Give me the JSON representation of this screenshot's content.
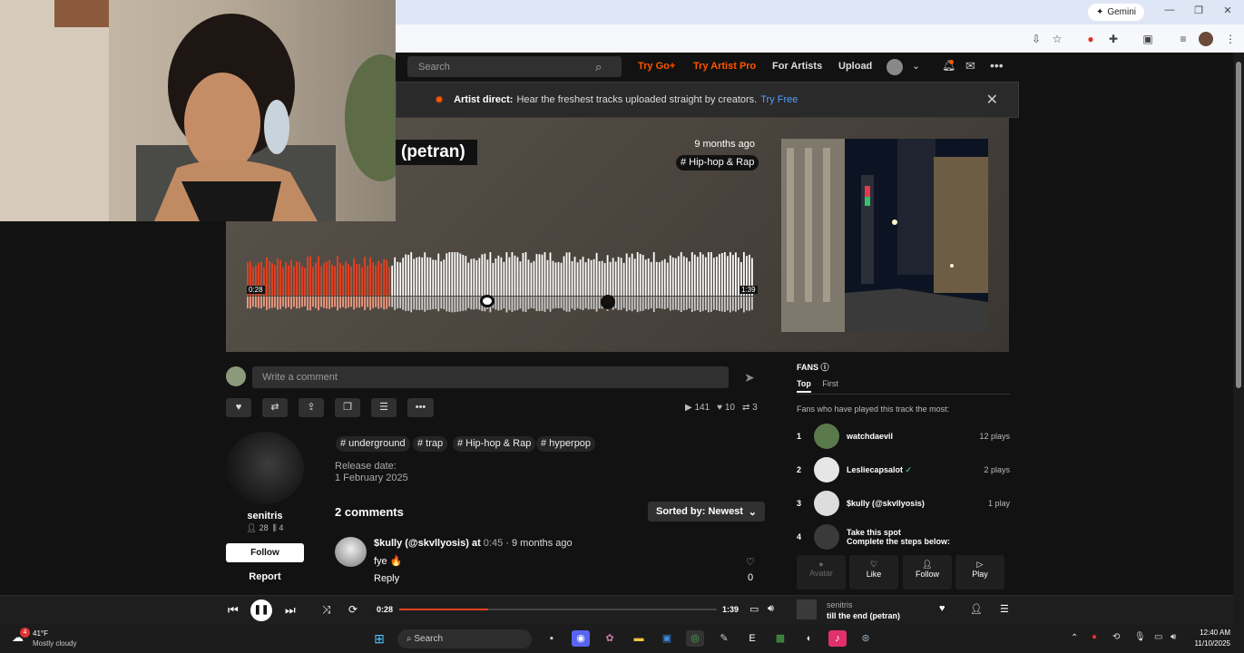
{
  "browser": {
    "gemini_label": "Gemini",
    "window_controls": [
      "minimize-icon",
      "maximize-icon",
      "close-icon"
    ]
  },
  "nav": {
    "search_placeholder": "Search",
    "try_go": "Try Go+",
    "try_artist_pro": "Try Artist Pro",
    "for_artists": "For Artists",
    "upload": "Upload"
  },
  "banner": {
    "bold": "Artist direct:",
    "text": "Hear the freshest tracks uploaded straight by creators.",
    "link": "Try Free"
  },
  "track": {
    "title_fragment": "(petran)",
    "age": "9 months ago",
    "genre_tag": "# Hip-hop & Rap",
    "elapsed_on_wave": "0:28",
    "duration_on_wave": "1:39",
    "played_fraction": 0.2826
  },
  "comment_box": {
    "placeholder": "Write a comment"
  },
  "stats": {
    "plays": "141",
    "likes": "10",
    "reposts": "3"
  },
  "uploader": {
    "name": "senitris",
    "followers": "28",
    "tracks": "4",
    "follow_label": "Follow",
    "report_label": "Report"
  },
  "tags": [
    "# underground",
    "# trap",
    "# Hip-hop & Rap",
    "# hyperpop"
  ],
  "release": {
    "label": "Release date:",
    "date": "1 February 2025"
  },
  "comments": {
    "count_label": "2 comments",
    "sort_label": "Sorted by: Newest",
    "items": [
      {
        "user": "$kully (@skvllyosis)",
        "at": "at",
        "timestamp": "0:45",
        "age": "· 9 months ago",
        "text": "fye 🔥",
        "reply": "Reply",
        "likes": "0"
      }
    ]
  },
  "fans": {
    "title": "FANS",
    "tab_top": "Top",
    "tab_first": "First",
    "description": "Fans who have played this track the most:",
    "list": [
      {
        "rank": "1",
        "name": "watchdaevil",
        "plays": "12 plays"
      },
      {
        "rank": "2",
        "name": "Lesliecapsalot",
        "plays": "2 plays"
      },
      {
        "rank": "3",
        "name": "$kully (@skvllyosis)",
        "plays": "1 play"
      },
      {
        "rank": "4",
        "name": "Take this spot",
        "plays": "",
        "subtitle": "Complete the steps below:"
      }
    ],
    "steps": [
      "Avatar",
      "Like",
      "Follow",
      "Play"
    ]
  },
  "player": {
    "elapsed": "0:28",
    "total": "1:39",
    "progress_fraction": 0.28,
    "artist": "senitris",
    "title": "till the end (petran)"
  },
  "taskbar": {
    "weather_temp": "41°F",
    "weather_desc": "Mostly cloudy",
    "weather_badge": "4",
    "search_label": "Search",
    "time": "12:40 AM",
    "date": "11/10/2025"
  },
  "colors": {
    "accent": "#ff5500",
    "played_wave": "#e8401f",
    "link_blue": "#4f9ef8",
    "background": "#121212"
  }
}
